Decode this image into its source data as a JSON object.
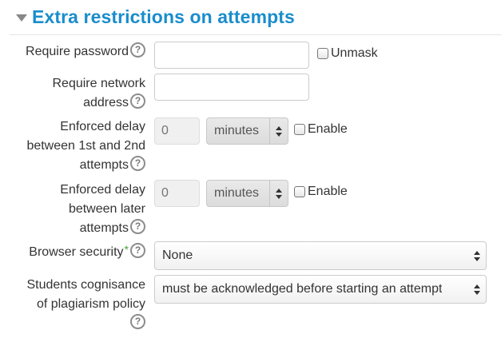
{
  "section": {
    "title": "Extra restrictions on attempts"
  },
  "fields": {
    "password": {
      "label": "Require password",
      "value": "",
      "unmask_label": "Unmask",
      "unmask_checked": false
    },
    "network": {
      "label_lines": [
        "Require network",
        "address"
      ],
      "value": ""
    },
    "delay1": {
      "label_lines": [
        "Enforced delay",
        "between 1st and 2nd",
        "attempts"
      ],
      "placeholder": "0",
      "unit": "minutes",
      "enable_label": "Enable",
      "enabled": false
    },
    "delay2": {
      "label_lines": [
        "Enforced delay",
        "between later",
        "attempts"
      ],
      "placeholder": "0",
      "unit": "minutes",
      "enable_label": "Enable",
      "enabled": false
    },
    "browser": {
      "label": "Browser security",
      "required_marker": "*",
      "value": "None"
    },
    "plagiarism": {
      "label_lines": [
        "Students cognisance",
        "of plagiarism policy"
      ],
      "value": "must be acknowledged before starting an attempt"
    }
  },
  "help_icon_glyph": "?"
}
